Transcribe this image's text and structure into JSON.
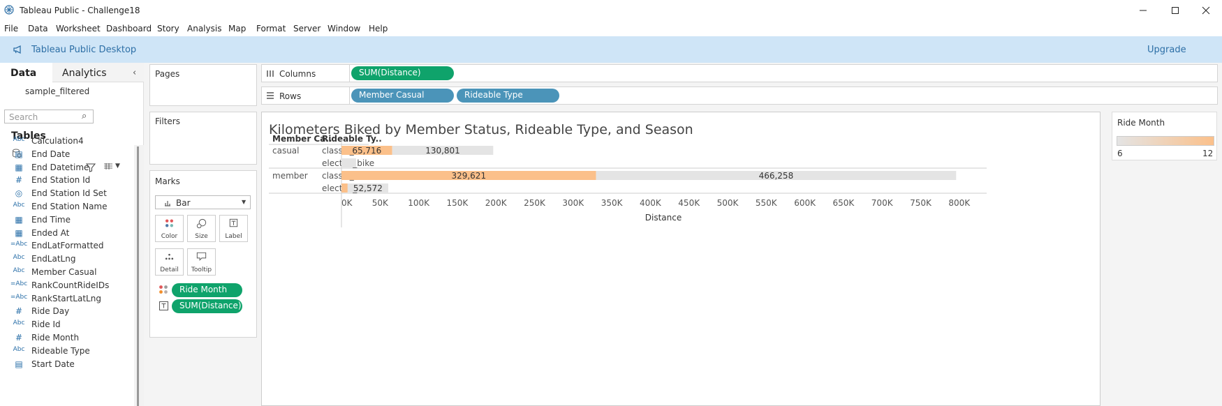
{
  "window": {
    "title": "Tableau Public - Challenge18"
  },
  "menu": [
    "File",
    "Data",
    "Worksheet",
    "Dashboard",
    "Story",
    "Analysis",
    "Map",
    "Format",
    "Server",
    "Window",
    "Help"
  ],
  "banner": {
    "product": "Tableau Public Desktop",
    "upgrade": "Upgrade"
  },
  "data_pane": {
    "tab_data": "Data",
    "tab_analytics": "Analytics",
    "datasource": "sample_filtered",
    "search_placeholder": "Search",
    "tables_header": "Tables",
    "fields": [
      {
        "type": "Abc",
        "icon": "calc-string-icon",
        "label": "Calculation4"
      },
      {
        "type": "date",
        "icon": "date-icon",
        "label": "End Date"
      },
      {
        "type": "datetime",
        "icon": "datetime-icon",
        "label": "End Datetime"
      },
      {
        "type": "#",
        "icon": "number-icon",
        "label": "End Station Id"
      },
      {
        "type": "set",
        "icon": "set-icon",
        "label": "End Station Id Set"
      },
      {
        "type": "Abc",
        "icon": "string-icon",
        "label": "End Station Name"
      },
      {
        "type": "datetime",
        "icon": "datetime-icon",
        "label": "End Time"
      },
      {
        "type": "datetime",
        "icon": "datetime-icon",
        "label": "Ended At"
      },
      {
        "type": "=Abc",
        "icon": "calc-string-icon",
        "label": "EndLatFormatted"
      },
      {
        "type": "Abc",
        "icon": "string-icon",
        "label": "EndLatLng"
      },
      {
        "type": "Abc",
        "icon": "string-icon",
        "label": "Member Casual"
      },
      {
        "type": "=Abc",
        "icon": "calc-string-icon",
        "label": "RankCountRideIDs"
      },
      {
        "type": "=Abc",
        "icon": "calc-string-icon",
        "label": "RankStartLatLng"
      },
      {
        "type": "#",
        "icon": "number-icon",
        "label": "Ride Day"
      },
      {
        "type": "Abc",
        "icon": "string-icon",
        "label": "Ride Id"
      },
      {
        "type": "#",
        "icon": "number-icon",
        "label": "Ride Month"
      },
      {
        "type": "Abc",
        "icon": "string-icon",
        "label": "Rideable Type"
      },
      {
        "type": "date",
        "icon": "date-icon",
        "label": "Start Date"
      }
    ]
  },
  "cards": {
    "pages": "Pages",
    "filters": "Filters",
    "marks": "Marks",
    "mark_type": "Bar",
    "mark_buttons": [
      "Color",
      "Size",
      "Label",
      "Detail",
      "Tooltip"
    ],
    "mark_pills": [
      "Ride Month",
      "SUM(Distance)"
    ]
  },
  "shelves": {
    "columns_label": "Columns",
    "rows_label": "Rows",
    "columns_pills": [
      "SUM(Distance)"
    ],
    "rows_pills": [
      "Member Casual",
      "Rideable Type"
    ]
  },
  "viz": {
    "title": "Kilometers Biked by Member Status, Rideable Type, and Season",
    "col_header_1": "Member Ca..",
    "col_header_2": "Rideable Ty..",
    "xlabel": "Distance"
  },
  "legend": {
    "title": "Ride Month",
    "min": "6",
    "max": "12",
    "color_low": "#e4e4e4",
    "color_high": "#fbc08a"
  },
  "colors": {
    "pill_green": "#0fa36b",
    "pill_blue": "#4b94b9",
    "banner_bg": "#cfe5f7",
    "bar_orange": "#fbc08a",
    "bar_gray": "#e4e4e4"
  },
  "chart_data": {
    "type": "bar",
    "orientation": "horizontal",
    "title": "Kilometers Biked by Member Status, Rideable Type, and Season",
    "xlabel": "Distance",
    "xlim": [
      0,
      840000
    ],
    "xticks": [
      0,
      50000,
      100000,
      150000,
      200000,
      250000,
      300000,
      350000,
      400000,
      450000,
      500000,
      550000,
      600000,
      650000,
      700000,
      750000,
      800000
    ],
    "xtick_labels": [
      "0K",
      "50K",
      "100K",
      "150K",
      "200K",
      "250K",
      "300K",
      "350K",
      "400K",
      "450K",
      "500K",
      "550K",
      "600K",
      "650K",
      "700K",
      "750K",
      "800K"
    ],
    "rows": [
      {
        "member": "casual",
        "rideable": "classic_bike",
        "segments": [
          {
            "value": 65716,
            "color": "orange",
            "label": "65,716"
          },
          {
            "value": 130801,
            "color": "gray",
            "label": "130,801"
          }
        ]
      },
      {
        "member": "",
        "rideable": "electric_bike",
        "segments": [
          {
            "value": 19000,
            "color": "gray",
            "label": ""
          }
        ]
      },
      {
        "member": "member",
        "rideable": "classic_bike",
        "segments": [
          {
            "value": 329621,
            "color": "orange",
            "label": "329,621"
          },
          {
            "value": 466258,
            "color": "gray",
            "label": "466,258"
          }
        ]
      },
      {
        "member": "",
        "rideable": "electric_bike",
        "segments": [
          {
            "value": 8000,
            "color": "orange",
            "label": ""
          },
          {
            "value": 52572,
            "color": "gray",
            "label": "52,572"
          }
        ]
      }
    ]
  }
}
